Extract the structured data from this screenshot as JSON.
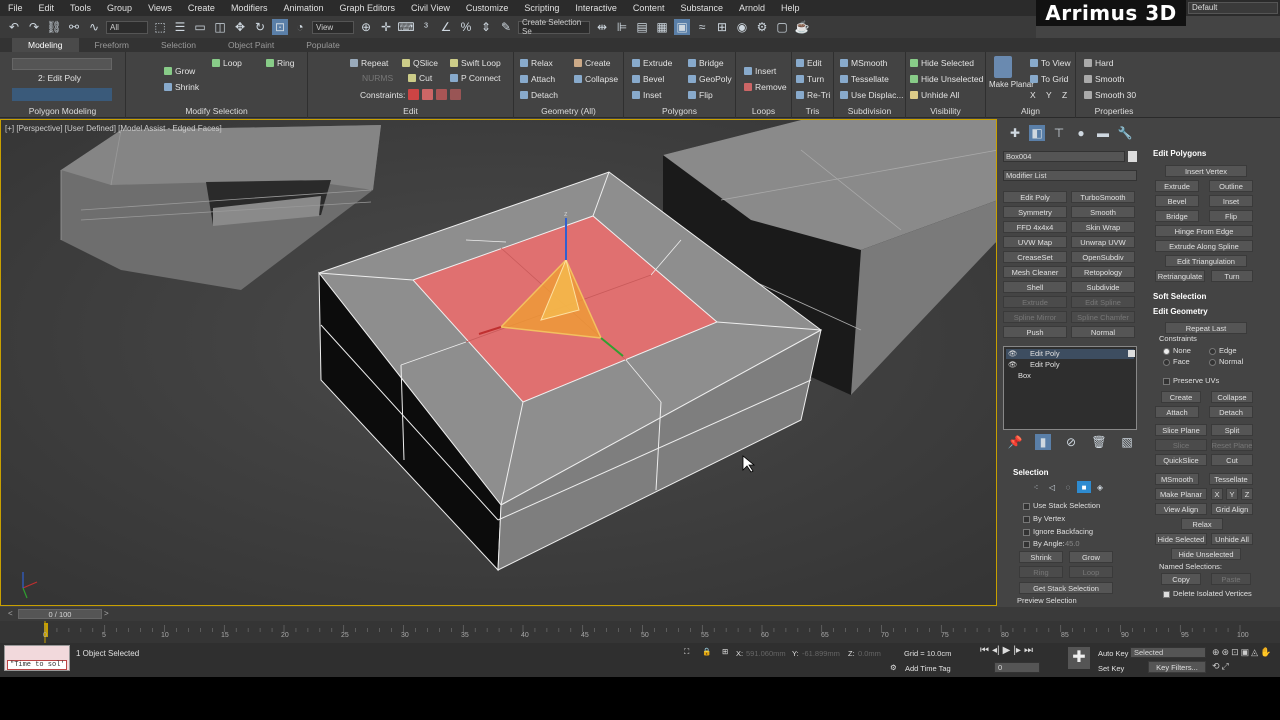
{
  "brand": "Arrimus 3D",
  "menu": [
    "File",
    "Edit",
    "Tools",
    "Group",
    "Views",
    "Create",
    "Modifiers",
    "Animation",
    "Graph Editors",
    "Civil View",
    "Customize",
    "Scripting",
    "Interactive",
    "Content",
    "Substance",
    "Arnold",
    "Help"
  ],
  "workspace": "Default",
  "maintoolbar": {
    "filter": "All",
    "refcoord": "View",
    "selset": "Create Selection Se"
  },
  "ribbon_tabs": [
    "Modeling",
    "Freeform",
    "Selection",
    "Object Paint",
    "Populate"
  ],
  "ribbon": {
    "polygon_modeling": {
      "name": "Polygon Modeling",
      "edit": "2: Edit Poly"
    },
    "modify_selection": {
      "name": "Modify Selection",
      "grow": "Grow",
      "shrink": "Shrink",
      "loop": "Loop",
      "ring": "Ring"
    },
    "edit": {
      "name": "Edit",
      "repeat": "Repeat",
      "qslice": "QSlice",
      "swift_loop": "Swift Loop",
      "nurms": "NURMS",
      "cut": "Cut",
      "p_connect": "P Connect",
      "constraints": "Constraints:"
    },
    "geometry": {
      "name": "Geometry (All)",
      "relax": "Relax",
      "create": "Create",
      "attach": "Attach",
      "collapse": "Collapse",
      "detach": "Detach"
    },
    "polygons": {
      "name": "Polygons",
      "extrude": "Extrude",
      "bridge": "Bridge",
      "bevel": "Bevel",
      "geopoly": "GeoPoly",
      "inset": "Inset",
      "flip": "Flip"
    },
    "loops": {
      "name": "Loops",
      "insert": "Insert",
      "remove": "Remove"
    },
    "tris": {
      "name": "Tris",
      "edit": "Edit",
      "turn": "Turn",
      "retri": "Re-Tri"
    },
    "subdivision": {
      "name": "Subdivision",
      "msmooth": "MSmooth",
      "tessellate": "Tessellate",
      "use_displac": "Use Displac..."
    },
    "visibility": {
      "name": "Visibility",
      "hide_selected": "Hide Selected",
      "hide_unselected": "Hide Unselected",
      "unhide_all": "Unhide All"
    },
    "align": {
      "name": "Align",
      "make_planar": "Make Planar",
      "to_view": "To View",
      "to_grid": "To Grid",
      "x": "X",
      "y": "Y",
      "z": "Z"
    },
    "properties": {
      "name": "Properties",
      "hard": "Hard",
      "smooth": "Smooth",
      "smooth30": "Smooth 30"
    }
  },
  "viewport": {
    "label": "[+] [Perspective] [User Defined] [Model Assist - Edged Faces]"
  },
  "cmdpanel": {
    "object_name": "Box004",
    "modifier_list": "Modifier List",
    "buttons": [
      "Edit Poly",
      "TurboSmooth",
      "Symmetry",
      "Smooth",
      "FFD 4x4x4",
      "Skin Wrap",
      "UVW Map",
      "Unwrap UVW",
      "CreaseSet",
      "OpenSubdiv",
      "Mesh Cleaner",
      "Retopology",
      "Shell",
      "Subdivide",
      "Extrude",
      "Edit Spline",
      "Spline Mirror",
      "Spline Chamfer",
      "Push",
      "Normal"
    ],
    "stack": [
      "Edit Poly",
      "Edit Poly",
      "Box"
    ],
    "selection": {
      "title": "Selection",
      "use_stack": "Use Stack Selection",
      "by_vertex": "By Vertex",
      "ignore_backfacing": "Ignore Backfacing",
      "by_angle": "By Angle:",
      "by_angle_val": "45.0",
      "shrink": "Shrink",
      "grow": "Grow",
      "ring": "Ring",
      "loop": "Loop",
      "get_stack": "Get Stack Selection",
      "preview": "Preview Selection"
    }
  },
  "rollout": {
    "edit_polygons": "Edit Polygons",
    "insert_vertex": "Insert Vertex",
    "extrude": "Extrude",
    "outline": "Outline",
    "bevel": "Bevel",
    "inset": "Inset",
    "bridge": "Bridge",
    "flip": "Flip",
    "hinge": "Hinge From Edge",
    "extrude_spline": "Extrude Along Spline",
    "edit_tri": "Edit Triangulation",
    "retriangulate": "Retriangulate",
    "turn": "Turn",
    "soft_selection": "Soft Selection",
    "edit_geometry": "Edit Geometry",
    "repeat_last": "Repeat Last",
    "constraints": "Constraints",
    "none": "None",
    "edge": "Edge",
    "face": "Face",
    "normal": "Normal",
    "preserve_uvs": "Preserve UVs",
    "create": "Create",
    "collapse": "Collapse",
    "attach": "Attach",
    "detach": "Detach",
    "slice_plane": "Slice Plane",
    "split": "Split",
    "slice": "Slice",
    "reset_plane": "Reset Plane",
    "quickslice": "QuickSlice",
    "cut": "Cut",
    "msmooth": "MSmooth",
    "tessellate": "Tessellate",
    "make_planar": "Make Planar",
    "x": "X",
    "y": "Y",
    "z": "Z",
    "view_align": "View Align",
    "grid_align": "Grid Align",
    "relax": "Relax",
    "hide_selected": "Hide Selected",
    "unhide_all": "Unhide All",
    "hide_unselected": "Hide Unselected",
    "named_selections": "Named Selections:",
    "copy": "Copy",
    "paste": "Paste",
    "delete_isolated": "Delete Isolated Vertices"
  },
  "timeline": {
    "frame": "0 / 100",
    "ticks": [
      "5",
      "10",
      "15",
      "20",
      "25",
      "30",
      "35",
      "40",
      "45",
      "50",
      "55",
      "60",
      "65",
      "70",
      "75",
      "80",
      "85",
      "90",
      "95",
      "100"
    ],
    "ticks_start": "0"
  },
  "status": {
    "script": "\"Time to sol'",
    "selected": "1 Object Selected",
    "x_label": "X:",
    "x_val": "591.060mm",
    "y_label": "Y:",
    "y_val": "-61.899mm",
    "z_label": "Z:",
    "z_val": "0.0mm",
    "grid": "Grid = 10.0cm",
    "add_time_tag": "Add Time Tag",
    "auto_key": "Auto Key",
    "set_key": "Set Key",
    "selected_dd": "Selected",
    "key_filters": "Key Filters...",
    "frame_field": "0"
  },
  "colors": {
    "selection": "#e07070",
    "gizmo": "#f0a030",
    "viewport_border": "#c8a000"
  }
}
